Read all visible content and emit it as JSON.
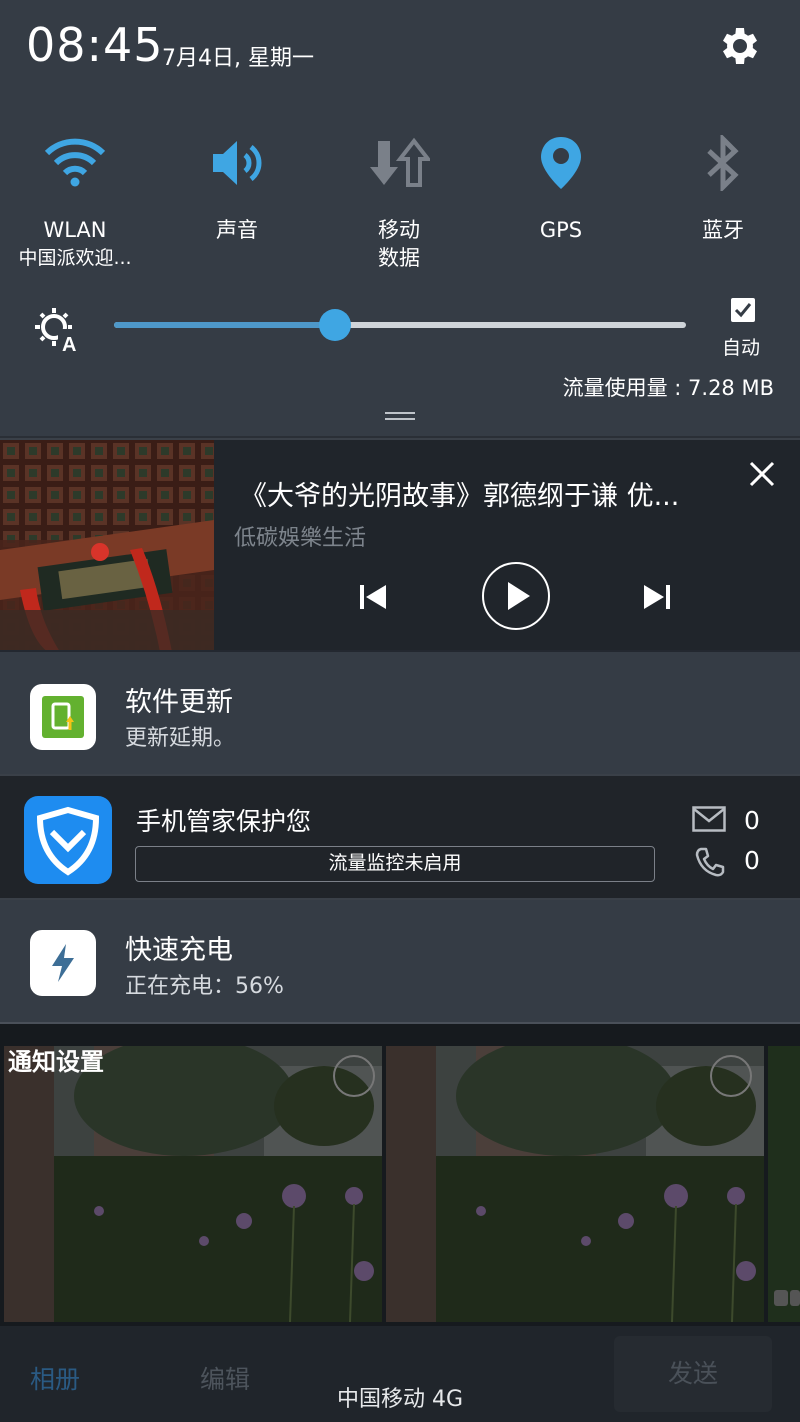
{
  "status": {
    "time": "08:45",
    "date": "7月4日, 星期一"
  },
  "tiles": [
    {
      "label": "WLAN",
      "sub": "中国派欢迎...",
      "icon": "wifi-icon",
      "color": "#3fa6e3"
    },
    {
      "label": "声音",
      "sub": "",
      "icon": "volume-icon",
      "color": "#3fa6e3"
    },
    {
      "label": "移动",
      "sub": "数据",
      "icon": "mobile-data-icon",
      "color": "#7a8089"
    },
    {
      "label": "GPS",
      "sub": "",
      "icon": "location-icon",
      "color": "#3fa6e3"
    },
    {
      "label": "蓝牙",
      "sub": "",
      "icon": "bluetooth-icon",
      "color": "#7a8089"
    }
  ],
  "brightness": {
    "level": 0.386,
    "auto_label": "自动",
    "auto_checked": true
  },
  "traffic": "流量使用量 : 7.28 MB",
  "media": {
    "title": "《大爷的光阴故事》郭德纲于谦 优...",
    "artist": "低碳娛樂生活"
  },
  "notifications": {
    "update": {
      "title": "软件更新",
      "text": "更新延期。"
    },
    "guard": {
      "title": "手机管家保护您",
      "bar": "流量监控未启用",
      "mail_count": "0",
      "call_count": "0"
    },
    "charge": {
      "title": "快速充电",
      "text": "正在充电：56%"
    }
  },
  "gallery": {
    "label": "通知设置"
  },
  "bottom": {
    "album": "相册",
    "edit": "编辑",
    "send": "发送",
    "carrier": "中国移动 4G"
  }
}
